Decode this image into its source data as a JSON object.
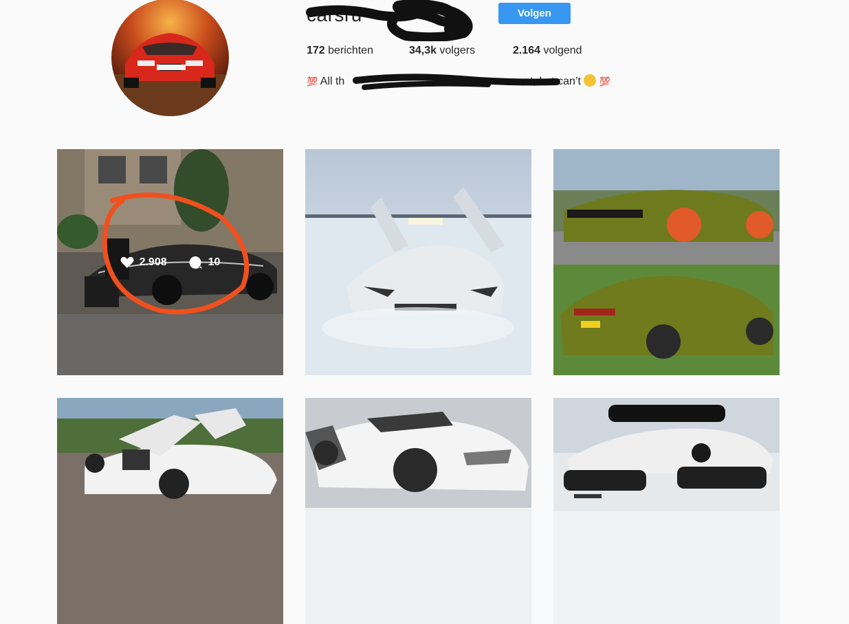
{
  "profile": {
    "username": "carsru",
    "follow_label": "Volgen",
    "stats": [
      {
        "count": "172",
        "label": "berichten"
      },
      {
        "count": "34,3k",
        "label": "volgers"
      },
      {
        "count": "2.164",
        "label": "volgend"
      }
    ],
    "bio": {
      "emoji_left": "💯",
      "text_start": "All th",
      "text_end": "ant, but can’t",
      "emoji_right": "💯"
    }
  },
  "posts": [
    {
      "likes": "2.908",
      "comments": "10"
    }
  ],
  "colors": {
    "follow_button": "#3897f0",
    "text": "#262626",
    "background": "#fafafa",
    "annotation_circle": "#f0501e"
  }
}
